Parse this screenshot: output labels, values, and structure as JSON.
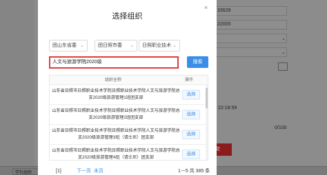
{
  "background": {
    "fields": [
      "33628",
      "22005",
      "",
      ""
    ],
    "time": "22:18:59",
    "counter": "0/100",
    "red_button": "交",
    "bottom_cell": "学社组织"
  },
  "modal": {
    "title": "选择组织",
    "close_glyph": "×",
    "filters": [
      {
        "label": "团山东省委"
      },
      {
        "label": "团日照市委"
      },
      {
        "label": "日照职业技术"
      }
    ],
    "search": {
      "value": "人文与旅游学院2020级",
      "button": "搜索"
    },
    "table": {
      "headers": {
        "name": "组织全称",
        "action": "操作"
      },
      "rows": [
        {
          "name": "山东省日照市日照职业技术学院日照职业技术学院人文与旅游学院总支2020级旅游管理1班团支部",
          "action": "选择"
        },
        {
          "name": "山东省日照市日照职业技术学院日照职业技术学院人文与旅游学院总支2020级旅游管理2班团支部",
          "action": "选择"
        },
        {
          "name": "山东省日照市日照职业技术学院日照职业技术学院人文与旅游学院总支2020级旅游管理3班（请士尼）团支部",
          "action": "选择"
        },
        {
          "name": "山东省日照市日照职业技术学院日照职业技术学院人文与旅游学院总支2020级旅游管理4班（请士尼）团支部",
          "action": "选择"
        }
      ]
    },
    "pager": {
      "page": "[1]",
      "next": "下一页",
      "last": "末页",
      "summary": "1－5 共 385 条"
    }
  }
}
